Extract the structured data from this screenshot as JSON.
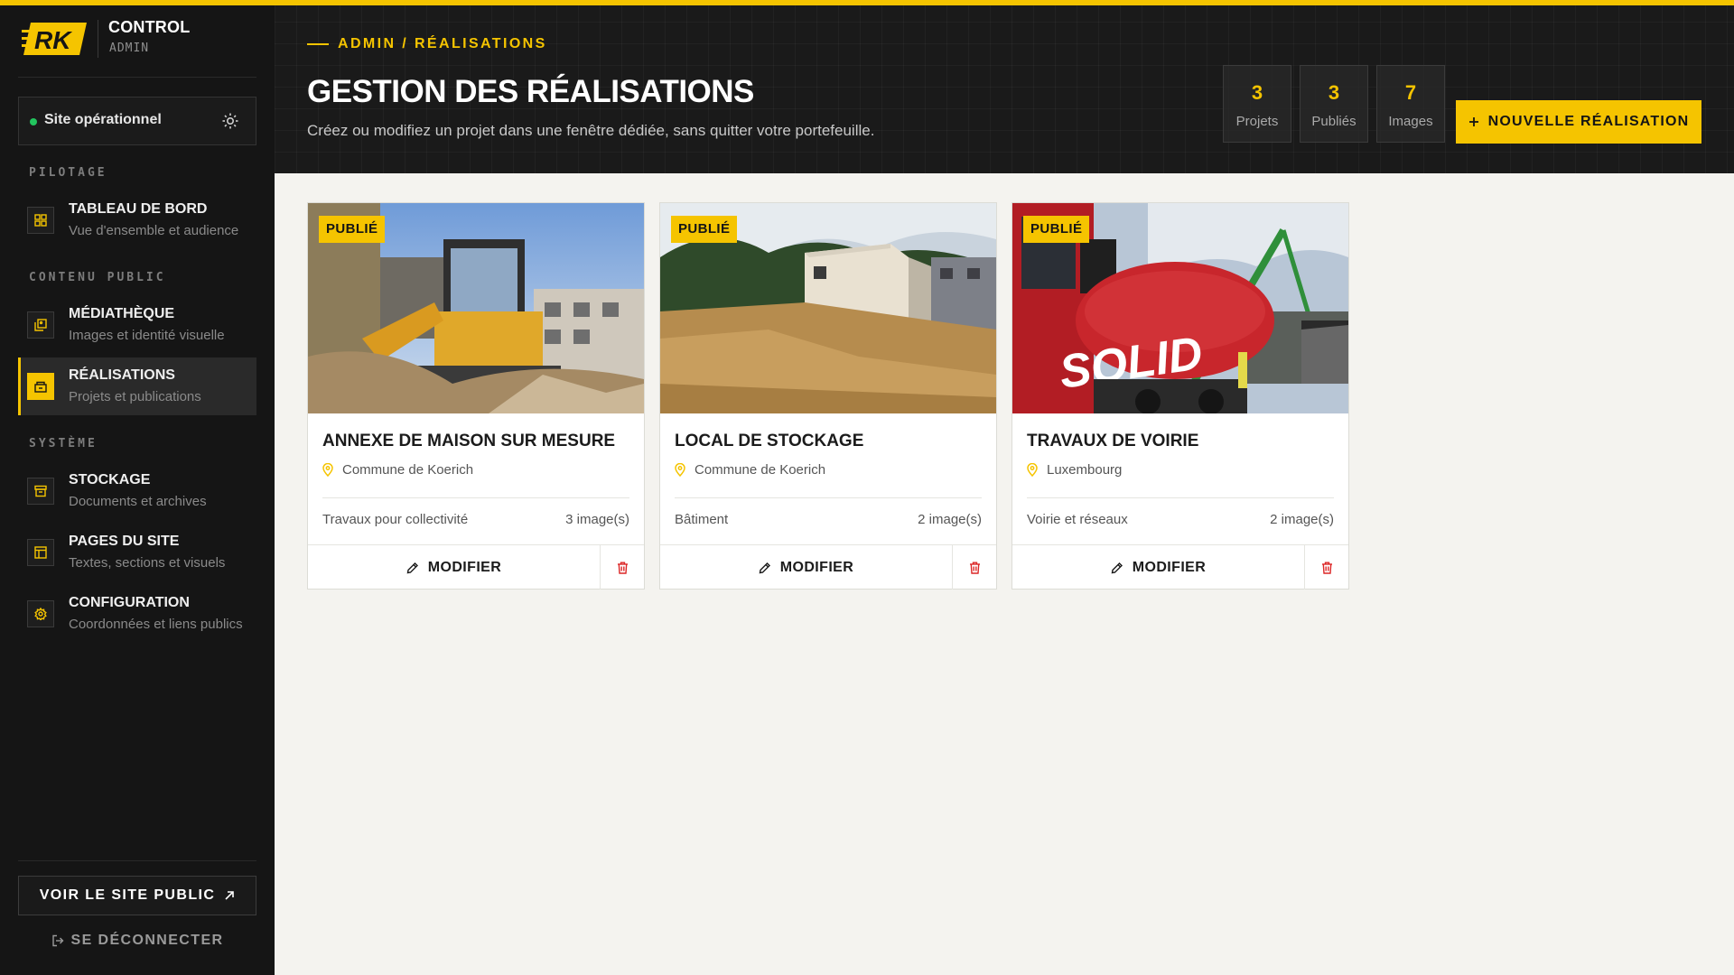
{
  "brand": {
    "title": "CONTROL",
    "subtitle": "ADMIN",
    "logo_text": "ERK"
  },
  "status": {
    "label": "Site opérationnel"
  },
  "sidebar": {
    "sections": [
      {
        "label": "PILOTAGE"
      },
      {
        "label": "CONTENU PUBLIC"
      },
      {
        "label": "SYSTÈME"
      }
    ],
    "items": [
      {
        "title": "TABLEAU DE BORD",
        "subtitle": "Vue d'ensemble et audience",
        "icon": "dashboard-icon",
        "active": false
      },
      {
        "title": "MÉDIATHÈQUE",
        "subtitle": "Images et identité visuelle",
        "icon": "media-icon",
        "active": false
      },
      {
        "title": "RÉALISATIONS",
        "subtitle": "Projets et publications",
        "icon": "projects-icon",
        "active": true
      },
      {
        "title": "STOCKAGE",
        "subtitle": "Documents et archives",
        "icon": "archive-icon",
        "active": false
      },
      {
        "title": "PAGES DU SITE",
        "subtitle": "Textes, sections et visuels",
        "icon": "pages-icon",
        "active": false
      },
      {
        "title": "CONFIGURATION",
        "subtitle": "Coordonnées et liens publics",
        "icon": "settings-icon",
        "active": false
      }
    ],
    "public_button": "VOIR LE SITE PUBLIC",
    "logout": "SE DÉCONNECTER"
  },
  "header": {
    "breadcrumb": "ADMIN / RÉALISATIONS",
    "title": "GESTION DES RÉALISATIONS",
    "subtitle": "Créez ou modifiez un projet dans une fenêtre dédiée, sans quitter votre portefeuille.",
    "stats": [
      {
        "value": "3",
        "label": "Projets"
      },
      {
        "value": "3",
        "label": "Publiés"
      },
      {
        "value": "7",
        "label": "Images"
      }
    ],
    "new_button": "NOUVELLE RÉALISATION"
  },
  "projects": [
    {
      "badge": "PUBLIÉ",
      "title": "ANNEXE DE MAISON SUR MESURE",
      "location": "Commune de Koerich",
      "category": "Travaux pour collectivité",
      "images": "3 image(s)",
      "modify": "MODIFIER"
    },
    {
      "badge": "PUBLIÉ",
      "title": "LOCAL DE STOCKAGE",
      "location": "Commune de Koerich",
      "category": "Bâtiment",
      "images": "2 image(s)",
      "modify": "MODIFIER"
    },
    {
      "badge": "PUBLIÉ",
      "title": "TRAVAUX DE VOIRIE",
      "location": "Luxembourg",
      "category": "Voirie et réseaux",
      "images": "2 image(s)",
      "modify": "MODIFIER"
    }
  ],
  "colors": {
    "accent": "#f5c400",
    "sidebar_bg": "#151515",
    "header_bg": "#1a1a1a",
    "status_ok": "#22c55e",
    "danger": "#dc2626"
  }
}
